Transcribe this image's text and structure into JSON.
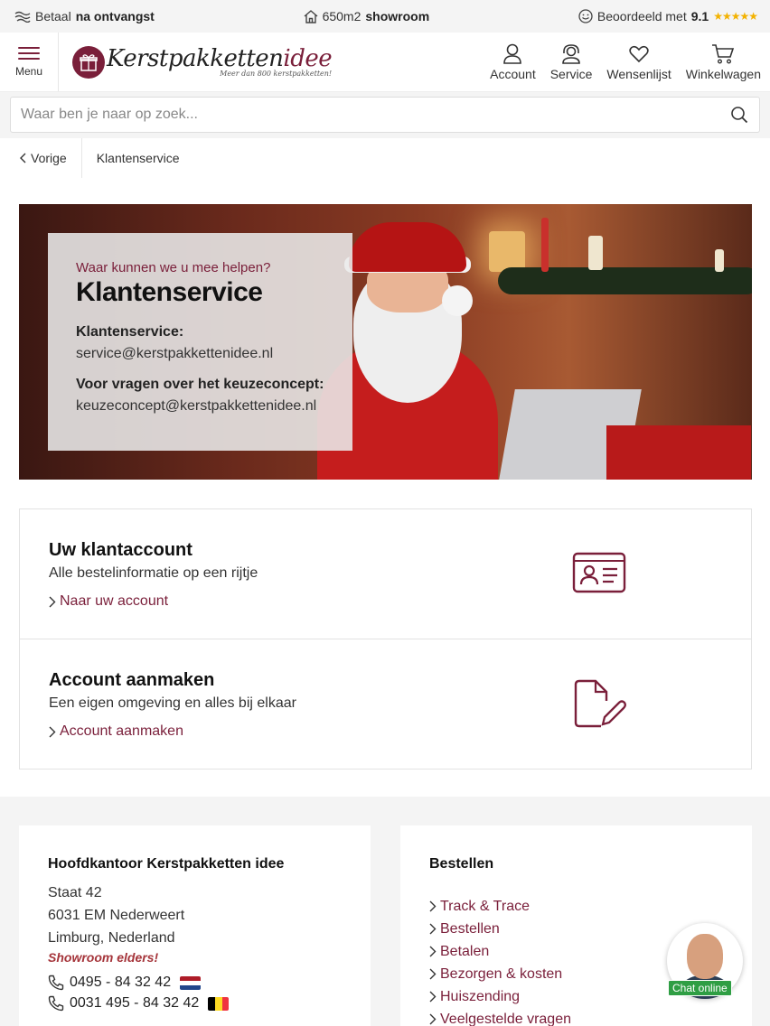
{
  "topbar": {
    "pay_prefix": "Betaal",
    "pay_bold": "na ontvangst",
    "showroom_prefix": "650m2",
    "showroom_bold": "showroom",
    "rating_prefix": "Beoordeeld met",
    "rating_value": "9.1",
    "rating_stars": "★★★★★"
  },
  "header": {
    "menu_label": "Menu",
    "logo_name_a": "Kerstpakketten",
    "logo_name_b": "idee",
    "logo_tagline": "Meer dan 800 kerstpakketten!",
    "nav": {
      "account": "Account",
      "service": "Service",
      "wishlist": "Wensenlijst",
      "cart": "Winkelwagen"
    }
  },
  "search": {
    "placeholder": "Waar ben je naar op zoek..."
  },
  "breadcrumb": {
    "back": "Vorige",
    "current": "Klantenservice"
  },
  "hero": {
    "subtitle": "Waar kunnen we u mee helpen?",
    "title": "Klantenservice",
    "label_1": "Klantenservice:",
    "email_1": "service@kerstpakkettenidee.nl",
    "label_2": "Voor vragen over het keuzeconcept:",
    "email_2": "keuzeconcept@kerstpakkettenidee.nl"
  },
  "cards": [
    {
      "title": "Uw klantaccount",
      "text": "Alle bestelinformatie op een rijtje",
      "link": "Naar uw account",
      "icon": "id-card-icon"
    },
    {
      "title": "Account aanmaken",
      "text": "Een eigen omgeving en alles bij elkaar",
      "link": "Account aanmaken",
      "icon": "edit-document-icon"
    }
  ],
  "footer": {
    "office": {
      "title": "Hoofdkantoor Kerstpakketten idee",
      "street": "Staat 42",
      "city": "6031 EM Nederweert",
      "region": "Limburg, Nederland",
      "showroom_link": "Showroom elders!",
      "phone_nl": "0495 - 84 32 42",
      "phone_be": "0031 495 - 84 32 42"
    },
    "order": {
      "title": "Bestellen",
      "links": [
        "Track & Trace",
        "Bestellen",
        "Betalen",
        "Bezorgen & kosten",
        "Huiszending",
        "Veelgestelde vragen"
      ]
    }
  },
  "chat": {
    "label": "Chat online"
  },
  "colors": {
    "brand": "#7a1f3a",
    "star": "#f3b200",
    "chat_green": "#2f9e44",
    "showroom_red": "#a5343a"
  }
}
